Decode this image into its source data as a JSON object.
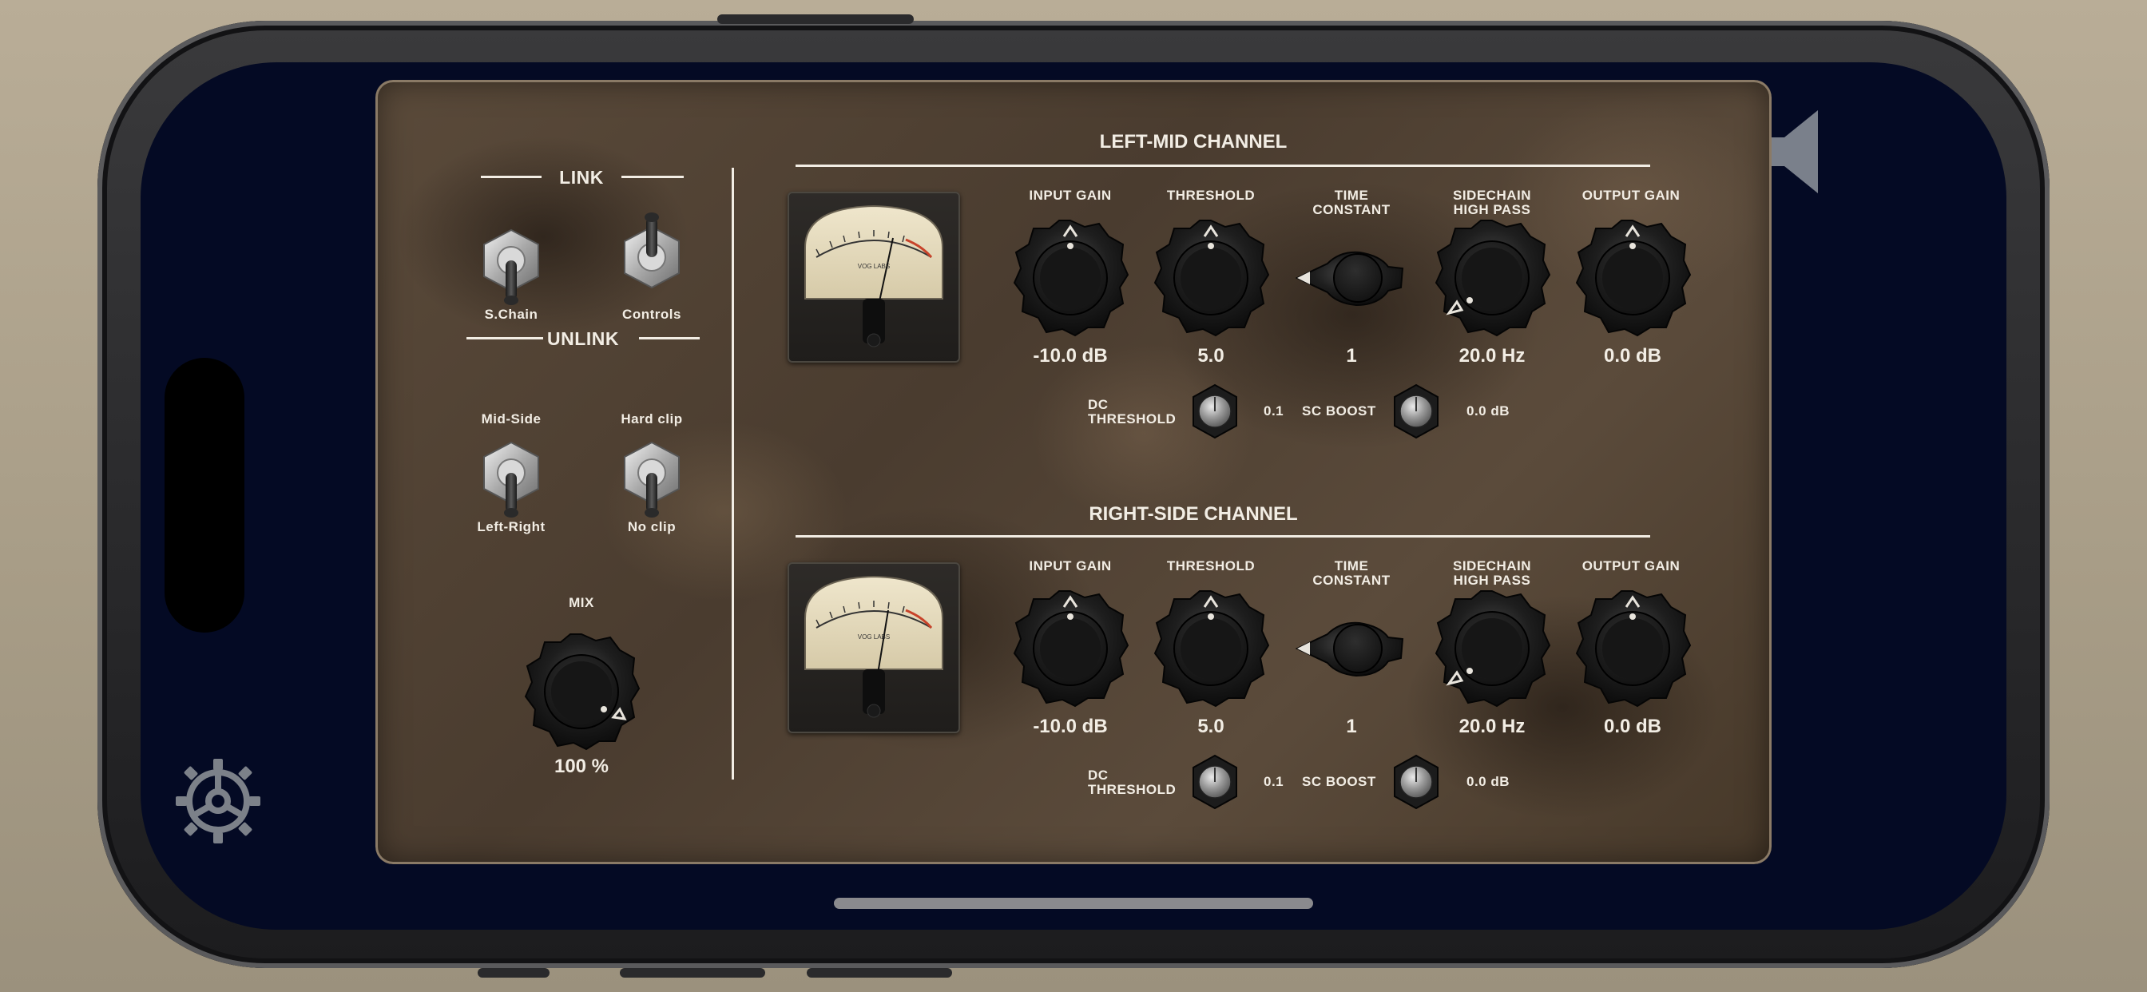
{
  "link_section": {
    "link_title": "LINK",
    "unlink_title": "UNLINK",
    "schain_label": "S.Chain",
    "controls_label": "Controls",
    "midside_label": "Mid-Side",
    "leftright_label": "Left-Right",
    "hardclip_label": "Hard clip",
    "noclip_label": "No clip",
    "mix_label": "MIX",
    "mix_value": "100 %"
  },
  "channels": [
    {
      "title": "LEFT-MID CHANNEL",
      "input_gain_label": "INPUT GAIN",
      "threshold_label": "THRESHOLD",
      "time_constant_label_1": "TIME",
      "time_constant_label_2": "CONSTANT",
      "sidechain_label_1": "SIDECHAIN",
      "sidechain_label_2": "HIGH PASS",
      "output_gain_label": "OUTPUT GAIN",
      "input_gain_value": "-10.0 dB",
      "threshold_value": "5.0",
      "time_constant_value": "1",
      "sidechain_value": "20.0 Hz",
      "output_gain_value": "0.0 dB",
      "dc_threshold_label_1": "DC",
      "dc_threshold_label_2": "THRESHOLD",
      "dc_threshold_value": "0.1",
      "sc_boost_label": "SC BOOST",
      "sc_boost_value": "0.0 dB"
    },
    {
      "title": "RIGHT-SIDE CHANNEL",
      "input_gain_label": "INPUT GAIN",
      "threshold_label": "THRESHOLD",
      "time_constant_label_1": "TIME",
      "time_constant_label_2": "CONSTANT",
      "sidechain_label_1": "SIDECHAIN",
      "sidechain_label_2": "HIGH PASS",
      "output_gain_label": "OUTPUT GAIN",
      "input_gain_value": "-10.0 dB",
      "threshold_value": "5.0",
      "time_constant_value": "1",
      "sidechain_value": "20.0 Hz",
      "output_gain_value": "0.0 dB",
      "dc_threshold_label_1": "DC",
      "dc_threshold_label_2": "THRESHOLD",
      "dc_threshold_value": "0.1",
      "sc_boost_label": "SC BOOST",
      "sc_boost_value": "0.0 dB"
    }
  ],
  "vu_meter": {
    "brand": "VOG LABS"
  },
  "colors": {
    "panel_text": "#f2ede4",
    "screen_bg": "#040a24",
    "vu_red": "#c8432a"
  },
  "icons": {
    "settings": "gear-icon",
    "speaker": "speaker-icon"
  }
}
